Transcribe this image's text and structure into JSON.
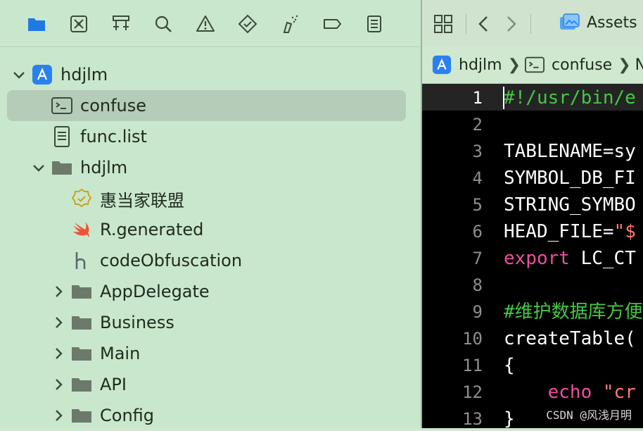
{
  "navigator": {
    "toolbar_icons": [
      "folder-icon",
      "source-control-icon",
      "hierarchy-icon",
      "search-icon",
      "warning-icon",
      "test-icon",
      "debug-icon",
      "breakpoint-icon",
      "report-icon"
    ],
    "tree": [
      {
        "label": "hdjlm",
        "icon": "app-project-icon",
        "disclosure": "expanded",
        "indent": 0
      },
      {
        "label": "confuse",
        "icon": "terminal-file-icon",
        "disclosure": "none",
        "indent": 1,
        "selected": true
      },
      {
        "label": "func.list",
        "icon": "text-file-icon",
        "disclosure": "none",
        "indent": 1
      },
      {
        "label": "hdjlm",
        "icon": "folder-icon",
        "disclosure": "expanded",
        "indent": 1
      },
      {
        "label": "惠当家联盟",
        "icon": "entitlements-badge-icon",
        "disclosure": "none",
        "indent": 2
      },
      {
        "label": "R.generated",
        "icon": "swift-icon",
        "disclosure": "none",
        "indent": 2
      },
      {
        "label": "codeObfuscation",
        "icon": "header-file-icon",
        "disclosure": "none",
        "indent": 2
      },
      {
        "label": "AppDelegate",
        "icon": "folder-icon",
        "disclosure": "collapsed",
        "indent": 2
      },
      {
        "label": "Business",
        "icon": "folder-icon",
        "disclosure": "collapsed",
        "indent": 2
      },
      {
        "label": "Main",
        "icon": "folder-icon",
        "disclosure": "collapsed",
        "indent": 2
      },
      {
        "label": "API",
        "icon": "folder-icon",
        "disclosure": "collapsed",
        "indent": 2
      },
      {
        "label": "Config",
        "icon": "folder-icon",
        "disclosure": "collapsed",
        "indent": 2
      }
    ]
  },
  "editor": {
    "tab_label": "Assets",
    "breadcrumb": [
      {
        "label": "hdjlm",
        "icon": "app-project-icon"
      },
      {
        "label": "confuse",
        "icon": "terminal-file-icon"
      },
      {
        "label": "No",
        "icon": ""
      }
    ],
    "lines": [
      {
        "n": "1",
        "text": "#!/usr/bin/e",
        "cls": "c-comment"
      },
      {
        "n": "2",
        "text": "",
        "cls": ""
      },
      {
        "n": "3",
        "text": "TABLENAME=sy",
        "cls": ""
      },
      {
        "n": "4",
        "text": "SYMBOL_DB_FI",
        "cls": ""
      },
      {
        "n": "5",
        "text": "STRING_SYMBO",
        "cls": ""
      },
      {
        "n": "6",
        "text": "HEAD_FILE=\"$",
        "cls": "mixed-head"
      },
      {
        "n": "7",
        "text": "export LC_CT",
        "cls": "mixed-export"
      },
      {
        "n": "8",
        "text": "",
        "cls": ""
      },
      {
        "n": "9",
        "text": "#维护数据库方便",
        "cls": "c-comment"
      },
      {
        "n": "10",
        "text": "createTable(",
        "cls": ""
      },
      {
        "n": "11",
        "text": "{",
        "cls": ""
      },
      {
        "n": "12",
        "text": "    echo \"cr",
        "cls": "mixed-echo"
      },
      {
        "n": "13",
        "text": "}",
        "cls": ""
      }
    ]
  },
  "watermark": "CSDN @风浅月明",
  "colors": {
    "navigator_bg": "#c9e7cc",
    "selection": "#b5ccb8",
    "code_bg": "#000000",
    "comment": "#45c845",
    "keyword": "#ee4fa0",
    "string": "#ff7a6e",
    "accent": "#1a73e8"
  }
}
